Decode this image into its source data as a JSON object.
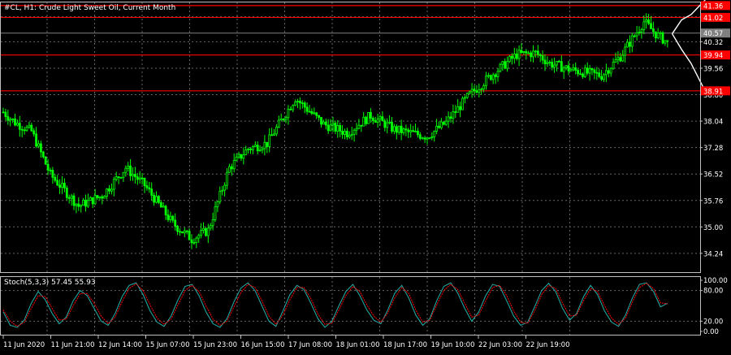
{
  "header": {
    "title": "#CL, H1:  Crude Light Sweet Oil, Current Month"
  },
  "indicator": {
    "label": "Stoch(5,3,3) 57.45 55.93"
  },
  "colors": {
    "background": "#000000",
    "grid": "#666666",
    "frame": "#c0c0c0",
    "bull": "#00ff00",
    "bear": "#00ff00",
    "level_line": "#ff0000",
    "level_label_bg": "#ff0000",
    "price_line": "#808080",
    "current_label_bg": "#808080",
    "main_line": "#20b2aa",
    "signal_line": "#ff0000",
    "axis_text": "#ffffff",
    "projection": "#ffffff"
  },
  "chart_data": [
    {
      "type": "candlestick",
      "title": "#CL, H1:  Crude Light Sweet Oil, Current Month",
      "grid": true,
      "ylim": [
        33.7,
        41.45
      ],
      "y_ticks": [
        "41.04",
        "40.32",
        "39.56",
        "38.80",
        "38.04",
        "37.28",
        "36.52",
        "35.76",
        "35.00",
        "34.24"
      ],
      "x_ticks": [
        "11 Jun 2020",
        "11 Jun 21:00",
        "12 Jun 14:00",
        "15 Jun 07:00",
        "15 Jun 23:00",
        "16 Jun 15:00",
        "17 Jun 08:00",
        "18 Jun 01:00",
        "18 Jun 17:00",
        "19 Jun 10:00",
        "22 Jun 03:00",
        "22 Jun 19:00"
      ],
      "levels": [
        {
          "value": 41.36,
          "label": "41.36"
        },
        {
          "value": 41.02,
          "label": "41.02"
        },
        {
          "value": 39.94,
          "label": "39.94"
        },
        {
          "value": 38.91,
          "label": "38.91"
        }
      ],
      "current_price": {
        "value": 40.57,
        "label": "40.57"
      },
      "close_path": [
        [
          0,
          38.3
        ],
        [
          5,
          38.0
        ],
        [
          12,
          37.75
        ],
        [
          20,
          36.5
        ],
        [
          32,
          35.6
        ],
        [
          42,
          35.9
        ],
        [
          52,
          36.7
        ],
        [
          60,
          36.2
        ],
        [
          72,
          35.1
        ],
        [
          80,
          34.65
        ],
        [
          87,
          34.9
        ],
        [
          96,
          36.7
        ],
        [
          104,
          37.25
        ],
        [
          112,
          37.4
        ],
        [
          124,
          38.7
        ],
        [
          136,
          37.95
        ],
        [
          146,
          37.7
        ],
        [
          156,
          38.2
        ],
        [
          166,
          37.8
        ],
        [
          180,
          37.6
        ],
        [
          188,
          38.0
        ],
        [
          198,
          38.8
        ],
        [
          208,
          39.4
        ],
        [
          218,
          39.95
        ],
        [
          226,
          40.0
        ],
        [
          232,
          39.7
        ],
        [
          242,
          39.5
        ],
        [
          254,
          39.35
        ],
        [
          262,
          39.9
        ],
        [
          272,
          40.9
        ],
        [
          277,
          40.55
        ],
        [
          282,
          40.3
        ]
      ],
      "projection": {
        "start": {
          "x": 284,
          "y": 40.55
        },
        "up": [
          [
            288,
            40.95
          ],
          [
            292,
            41.1
          ],
          [
            298,
            41.52
          ]
        ],
        "down": [
          [
            288,
            40.1
          ],
          [
            292,
            39.7
          ],
          [
            298,
            38.9
          ]
        ]
      }
    },
    {
      "type": "line",
      "name": "Stoch(5,3,3)",
      "ylim": [
        0,
        100
      ],
      "y_ticks": [
        "100.00",
        "80.00",
        "20.00",
        "0.00"
      ],
      "levels": [
        80,
        20
      ],
      "series": [
        {
          "name": "main",
          "values": [
            38,
            12,
            8,
            22,
            55,
            78,
            62,
            35,
            15,
            28,
            60,
            80,
            70,
            45,
            20,
            12,
            35,
            68,
            90,
            95,
            72,
            40,
            18,
            10,
            30,
            62,
            88,
            92,
            70,
            38,
            15,
            8,
            25,
            58,
            85,
            95,
            80,
            50,
            20,
            10,
            40,
            72,
            90,
            82,
            55,
            25,
            8,
            20,
            50,
            78,
            92,
            70,
            42,
            22,
            15,
            42,
            75,
            90,
            65,
            32,
            12,
            25,
            60,
            88,
            95,
            75,
            45,
            20,
            38,
            70,
            92,
            88,
            60,
            30,
            12,
            18,
            48,
            80,
            94,
            78,
            45,
            22,
            35,
            68,
            90,
            72,
            40,
            18,
            10,
            32,
            66,
            92,
            95,
            78,
            48,
            55
          ]
        },
        {
          "name": "signal",
          "values": [
            42,
            20,
            10,
            18,
            45,
            70,
            68,
            45,
            22,
            24,
            50,
            74,
            74,
            55,
            30,
            15,
            28,
            58,
            84,
            93,
            80,
            52,
            26,
            14,
            24,
            52,
            80,
            90,
            78,
            50,
            24,
            12,
            20,
            48,
            76,
            92,
            86,
            60,
            30,
            14,
            32,
            62,
            86,
            86,
            64,
            34,
            14,
            16,
            42,
            70,
            88,
            78,
            52,
            30,
            18,
            36,
            66,
            86,
            74,
            42,
            18,
            22,
            52,
            80,
            92,
            82,
            55,
            28,
            32,
            60,
            86,
            90,
            70,
            40,
            18,
            16,
            40,
            72,
            90,
            84,
            55,
            30,
            32,
            60,
            84,
            78,
            50,
            26,
            14,
            26,
            58,
            86,
            94,
            84,
            56,
            54
          ]
        }
      ]
    }
  ]
}
